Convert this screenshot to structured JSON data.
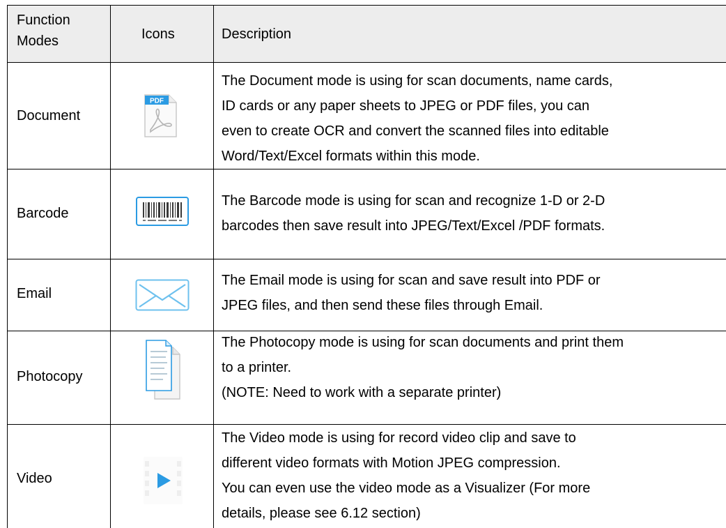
{
  "table": {
    "headers": {
      "function_modes_line1": "Function",
      "function_modes_line2": "Modes",
      "icons": "Icons",
      "description": "Description"
    },
    "rows": [
      {
        "mode": "Document",
        "icon": "pdf-file-icon",
        "icon_label": "PDF",
        "description": [
          "The Document mode is using for scan documents, name cards,",
          "ID cards or any paper sheets to JPEG or PDF files, you can",
          "even to create OCR and convert the scanned files into editable",
          "Word/Text/Excel formats within this mode."
        ]
      },
      {
        "mode": "Barcode",
        "icon": "barcode-icon",
        "description": [
          "The Barcode mode is using for scan and recognize 1-D or 2-D",
          "barcodes then save result into JPEG/Text/Excel /PDF formats."
        ]
      },
      {
        "mode": "Email",
        "icon": "envelope-icon",
        "description": [
          "The Email mode is using for scan and save result into PDF or",
          "JPEG files, and then send these files through Email."
        ]
      },
      {
        "mode": "Photocopy",
        "icon": "photocopy-icon",
        "description": [
          "The Photocopy mode is using for scan documents and print them",
          "to a printer.",
          "(NOTE: Need to work with a separate printer)"
        ]
      },
      {
        "mode": "Video",
        "icon": "video-play-icon",
        "description": [
          "The Video mode is using for record video clip and save to",
          "different video formats with Motion JPEG compression.",
          "You can even use the video mode as a Visualizer (For more",
          "details, please see 6.12 section)"
        ]
      }
    ],
    "colors": {
      "header_bg": "#ededed",
      "border": "#000000",
      "icon_blue": "#2b9be3"
    }
  }
}
